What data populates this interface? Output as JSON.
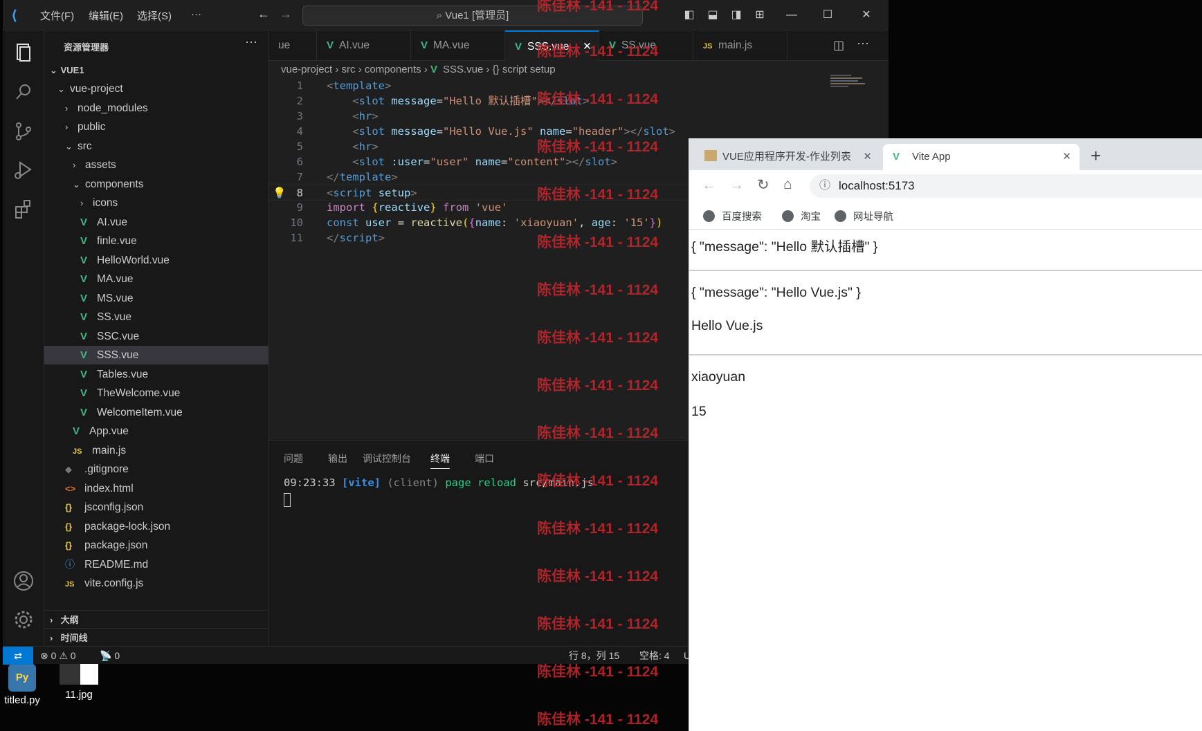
{
  "desktop": {
    "icons": [
      {
        "label": "titled.py"
      },
      {
        "label": "11.jpg"
      }
    ]
  },
  "vscode": {
    "menu": [
      "文件(F)",
      "编辑(E)",
      "选择(S)",
      "···"
    ],
    "command_center": "Vue1 [管理员]",
    "sidebar_title": "资源管理器",
    "workspace": "VUE1",
    "tree": [
      {
        "label": "vue-project",
        "type": "folder-open",
        "depth": 1
      },
      {
        "label": "node_modules",
        "type": "folder",
        "depth": 2
      },
      {
        "label": "public",
        "type": "folder",
        "depth": 2
      },
      {
        "label": "src",
        "type": "folder-open",
        "depth": 2
      },
      {
        "label": "assets",
        "type": "folder",
        "depth": 3
      },
      {
        "label": "components",
        "type": "folder-open",
        "depth": 3
      },
      {
        "label": "icons",
        "type": "folder",
        "depth": 4
      },
      {
        "label": "AI.vue",
        "type": "vue",
        "depth": 4
      },
      {
        "label": "finle.vue",
        "type": "vue",
        "depth": 4
      },
      {
        "label": "HelloWorld.vue",
        "type": "vue",
        "depth": 4
      },
      {
        "label": "MA.vue",
        "type": "vue",
        "depth": 4
      },
      {
        "label": "MS.vue",
        "type": "vue",
        "depth": 4
      },
      {
        "label": "SS.vue",
        "type": "vue",
        "depth": 4
      },
      {
        "label": "SSC.vue",
        "type": "vue",
        "depth": 4
      },
      {
        "label": "SSS.vue",
        "type": "vue",
        "depth": 4,
        "active": true
      },
      {
        "label": "Tables.vue",
        "type": "vue",
        "depth": 4
      },
      {
        "label": "TheWelcome.vue",
        "type": "vue",
        "depth": 4
      },
      {
        "label": "WelcomeItem.vue",
        "type": "vue",
        "depth": 4
      },
      {
        "label": "App.vue",
        "type": "vue",
        "depth": 3
      },
      {
        "label": "main.js",
        "type": "js",
        "depth": 3
      },
      {
        "label": ".gitignore",
        "type": "git",
        "depth": 2
      },
      {
        "label": "index.html",
        "type": "html",
        "depth": 2
      },
      {
        "label": "jsconfig.json",
        "type": "json",
        "depth": 2
      },
      {
        "label": "package-lock.json",
        "type": "json",
        "depth": 2
      },
      {
        "label": "package.json",
        "type": "json",
        "depth": 2
      },
      {
        "label": "README.md",
        "type": "info",
        "depth": 2
      },
      {
        "label": "vite.config.js",
        "type": "js",
        "depth": 2
      }
    ],
    "outline": "大纲",
    "timeline": "时间线",
    "tabs": [
      {
        "label": "ue",
        "icon": ""
      },
      {
        "label": "AI.vue",
        "icon": "vue"
      },
      {
        "label": "MA.vue",
        "icon": "vue"
      },
      {
        "label": "SSS.vue",
        "icon": "vue",
        "active": true
      },
      {
        "label": "SS.vue",
        "icon": "vue"
      },
      {
        "label": "main.js",
        "icon": "js"
      }
    ],
    "breadcrumbs": [
      "vue-project",
      "src",
      "components",
      "SSS.vue",
      "{} script setup"
    ],
    "code_lines": [
      {
        "n": "1"
      },
      {
        "n": "2"
      },
      {
        "n": "3"
      },
      {
        "n": "4"
      },
      {
        "n": "5"
      },
      {
        "n": "6"
      },
      {
        "n": "7"
      },
      {
        "n": "8"
      },
      {
        "n": "9"
      },
      {
        "n": "10"
      },
      {
        "n": "11"
      }
    ],
    "panel_tabs": [
      "问题",
      "输出",
      "调试控制台",
      "终端",
      "端口"
    ],
    "terminal": {
      "time": "09:23:33",
      "tag": "[vite]",
      "client": "(client)",
      "msg": "page reload",
      "file": "src/main.js"
    },
    "status": {
      "errors": "0",
      "warnings": "0",
      "ports": "0",
      "position": "行 8，列 15",
      "spaces": "空格: 4",
      "encoding": "U"
    }
  },
  "browser": {
    "tabs": [
      {
        "label": "VUE应用程序开发-作业列表"
      },
      {
        "label": "Vite App",
        "active": true
      }
    ],
    "address": "localhost:5173",
    "bookmarks": [
      "百度搜索",
      "淘宝",
      "网址导航"
    ],
    "content": {
      "line1": "{ \"message\": \"Hello 默认插槽\" }",
      "line2": "{ \"message\": \"Hello Vue.js\" }",
      "line3": "Hello Vue.js",
      "line4": "xiaoyuan",
      "line5": "15"
    }
  },
  "watermark": "陈佳林 -141 - 1124"
}
